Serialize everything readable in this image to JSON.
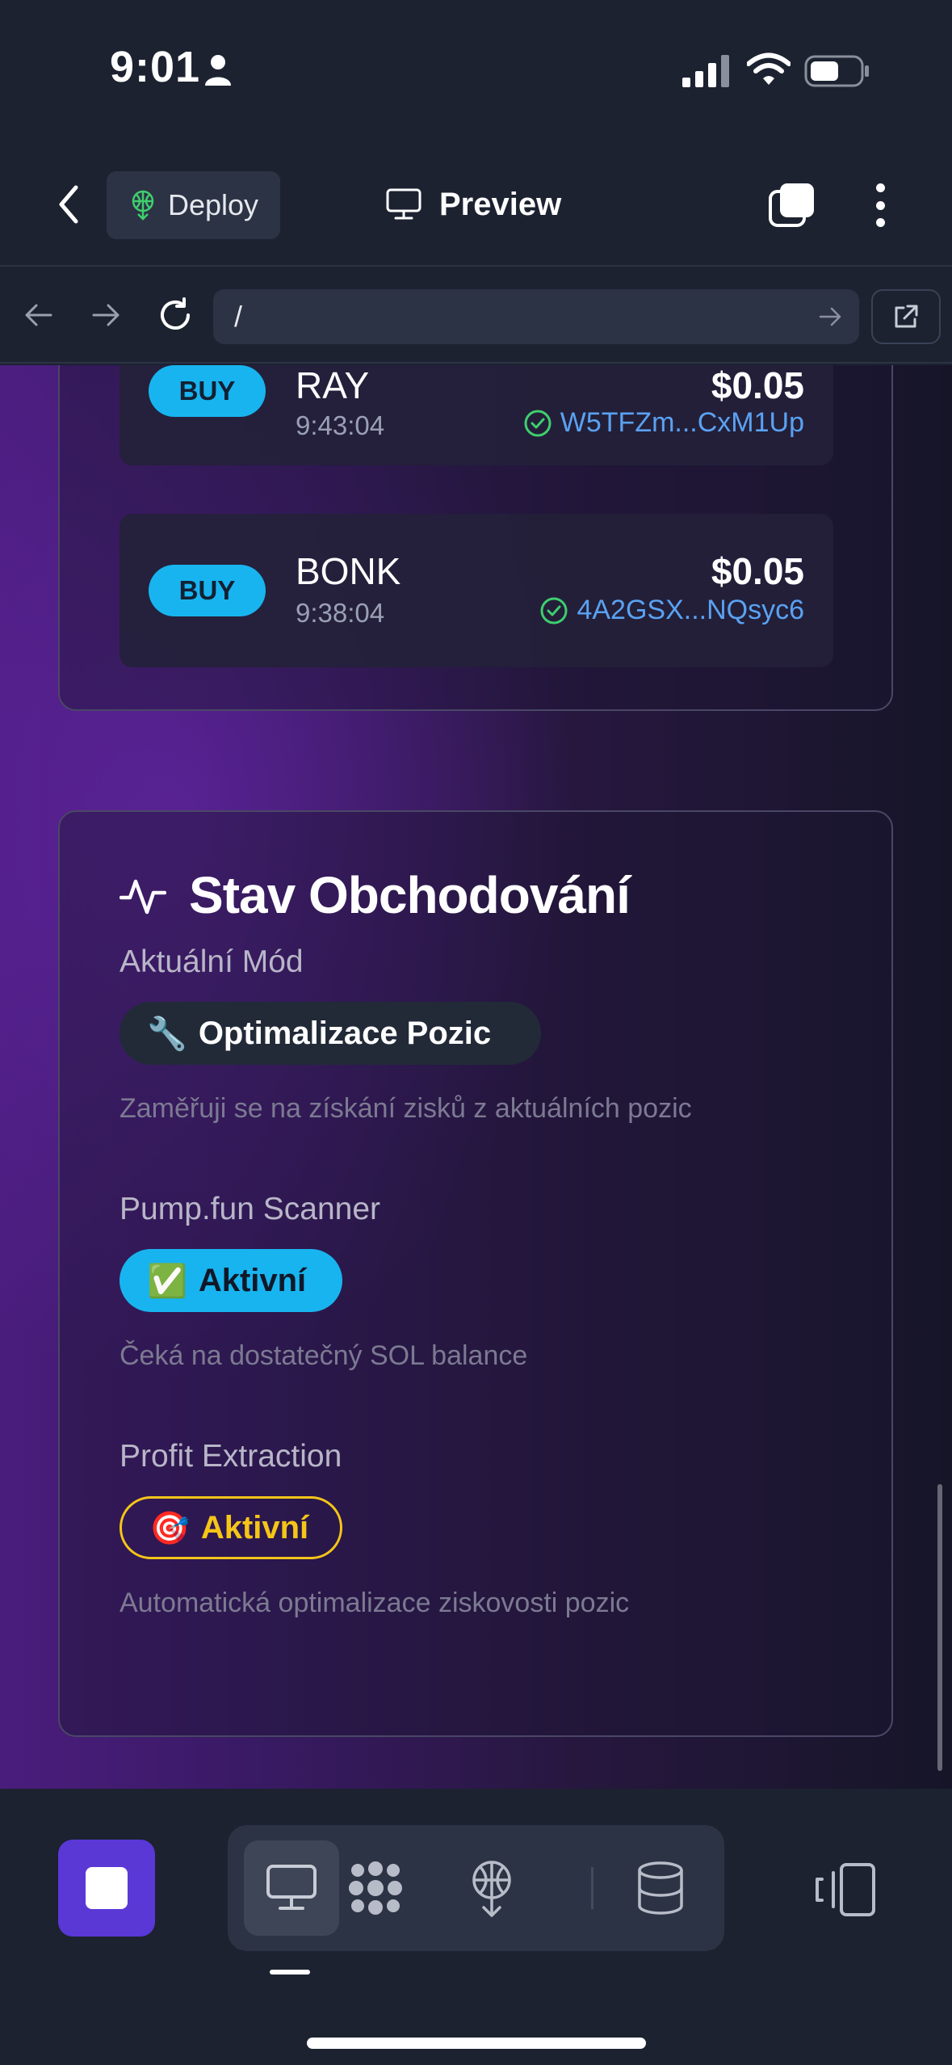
{
  "status_bar": {
    "time": "9:01"
  },
  "header": {
    "deploy_label": "Deploy",
    "preview_label": "Preview"
  },
  "browser": {
    "url": "/"
  },
  "trades": [
    {
      "side": "BUY",
      "symbol": "RAY",
      "time": "9:43:04",
      "amount": "$0.05",
      "tx": "W5TFZm...CxM1Up"
    },
    {
      "side": "BUY",
      "symbol": "BONK",
      "time": "9:38:04",
      "amount": "$0.05",
      "tx": "4A2GSX...NQsyc6"
    }
  ],
  "trading_status": {
    "title": "Stav Obchodování",
    "current_mode": {
      "label": "Aktuální Mód",
      "emoji": "🔧",
      "value": "Optimalizace Pozic",
      "description": "Zaměřuji se na získání zisků z aktuálních pozic"
    },
    "scanner": {
      "label": "Pump.fun Scanner",
      "emoji": "✅",
      "value": "Aktivní",
      "description": "Čeká na dostatečný SOL balance"
    },
    "profit_extraction": {
      "label": "Profit Extraction",
      "emoji": "🎯",
      "value": "Aktivní",
      "description": "Automatická optimalizace ziskovosti pozic"
    }
  },
  "colors": {
    "accent_blue": "#18b4ef",
    "accent_yellow": "#f5c518",
    "stop_purple": "#5a38d6",
    "tx_link": "#5aa2f2",
    "success_green": "#3ecf6e"
  },
  "bottom_toolbar": {
    "icons": [
      "stop-icon",
      "desktop-icon",
      "agents-icon",
      "deploy-icon",
      "database-icon",
      "devices-icon"
    ]
  }
}
